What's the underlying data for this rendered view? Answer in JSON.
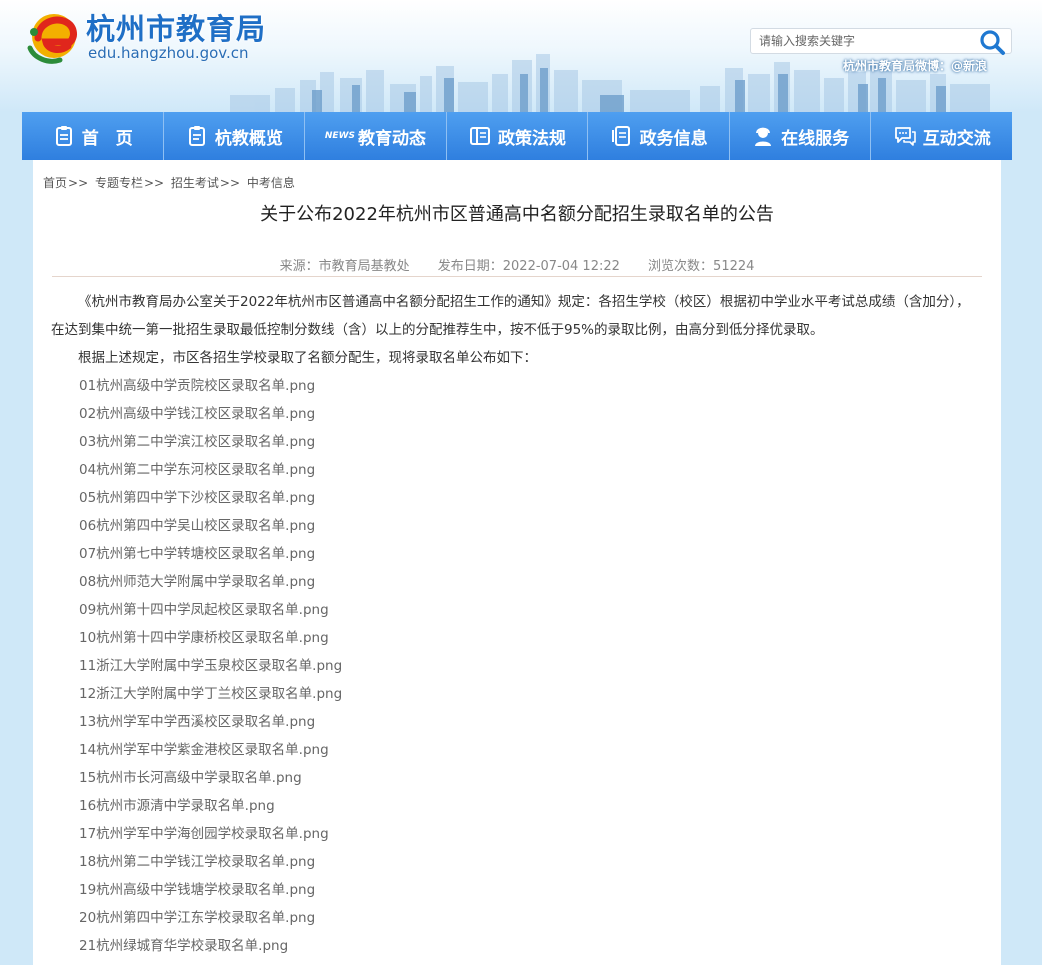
{
  "header": {
    "site_title": "杭州市教育局",
    "site_domain": "edu.hangzhou.gov.cn",
    "search_placeholder": "请输入搜索关键字",
    "weibo_text": "杭州市教育局微博：@新浪",
    "icons": {
      "search": "magnifier-icon",
      "logo": "logo-mark-icon"
    }
  },
  "nav": {
    "items": [
      {
        "label": "首　页",
        "icon": "home-icon"
      },
      {
        "label": "杭教概览",
        "icon": "document-icon"
      },
      {
        "label": "教育动态",
        "icon": "news-icon",
        "icon_text": "NEWS"
      },
      {
        "label": "政策法规",
        "icon": "book-icon"
      },
      {
        "label": "政务信息",
        "icon": "list-icon"
      },
      {
        "label": "在线服务",
        "icon": "user-service-icon"
      },
      {
        "label": "互动交流",
        "icon": "chat-icon"
      }
    ]
  },
  "breadcrumb": {
    "items": [
      "首页",
      "专题专栏",
      "招生考试",
      "中考信息"
    ],
    "separator": ">>"
  },
  "article": {
    "title": "关于公布2022年杭州市区普通高中名额分配招生录取名单的公告",
    "source": "来源：市教育局基教处",
    "date": "发布日期：2022-07-04 12:22",
    "views": "浏览次数：51224",
    "paragraphs": [
      "《杭州市教育局办公室关于2022年杭州市区普通高中名额分配招生工作的通知》规定：各招生学校（校区）根据初中学业水平考试总成绩（含加分），在达到集中统一第一批招生录取最低控制分数线（含）以上的分配推荐生中，按不低于95%的录取比例，由高分到低分择优录取。",
      "根据上述规定，市区各招生学校录取了名额分配生，现将录取名单公布如下："
    ],
    "files": [
      "01杭州高级中学贡院校区录取名单.png",
      "02杭州高级中学钱江校区录取名单.png",
      "03杭州第二中学滨江校区录取名单.png",
      "04杭州第二中学东河校区录取名单.png",
      "05杭州第四中学下沙校区录取名单.png",
      "06杭州第四中学吴山校区录取名单.png",
      "07杭州第七中学转塘校区录取名单.png",
      "08杭州师范大学附属中学录取名单.png",
      "09杭州第十四中学凤起校区录取名单.png",
      "10杭州第十四中学康桥校区录取名单.png",
      "11浙江大学附属中学玉泉校区录取名单.png",
      "12浙江大学附属中学丁兰校区录取名单.png",
      "13杭州学军中学西溪校区录取名单.png",
      "14杭州学军中学紫金港校区录取名单.png",
      "15杭州市长河高级中学录取名单.png",
      "16杭州市源清中学录取名单.png",
      "17杭州学军中学海创园学校录取名单.png",
      "18杭州第二中学钱江学校录取名单.png",
      "19杭州高级中学钱塘学校录取名单.png",
      "20杭州第四中学江东学校录取名单.png",
      "21杭州绿城育华学校录取名单.png"
    ]
  },
  "colors": {
    "nav_top": "#4f9ff0",
    "nav_bottom": "#2f7fdf",
    "page_bg": "#cfe8f8",
    "title_blue": "#1f6fc6"
  }
}
